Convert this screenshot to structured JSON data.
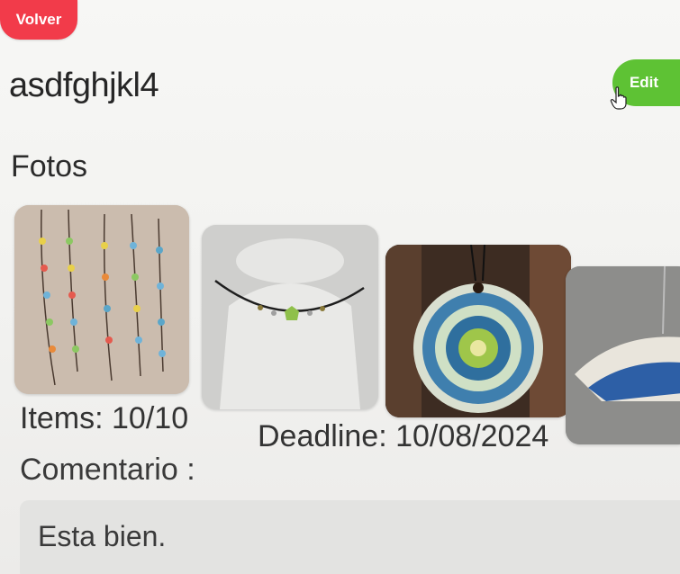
{
  "header": {
    "back_label": "Volver",
    "edit_label": "Edit"
  },
  "order": {
    "title": "asdfghjkl4",
    "photos_heading": "Fotos",
    "photos": [
      {
        "subject": "beaded-necklaces-photo"
      },
      {
        "subject": "choker-on-bust-photo"
      },
      {
        "subject": "mandala-pendant-photo"
      },
      {
        "subject": "ceramic-fan-pendant-photo"
      }
    ],
    "items_text": "Items: 10/10",
    "deadline_text": "Deadline: 10/08/2024",
    "comment_label": "Comentario :",
    "comment_value": "Esta bien."
  },
  "colors": {
    "back_button": "#f23b4a",
    "edit_button": "#5ec234"
  },
  "icons": {
    "cursor": "hand-pointer-icon"
  }
}
